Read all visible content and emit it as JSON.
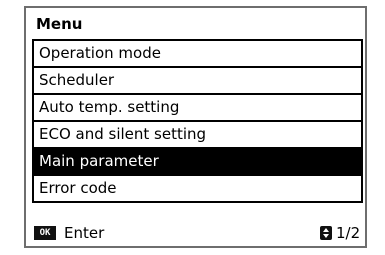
{
  "screen": {
    "title": "Menu",
    "items": [
      {
        "label": "Operation mode",
        "selected": false
      },
      {
        "label": "Scheduler",
        "selected": false
      },
      {
        "label": "Auto temp. setting",
        "selected": false
      },
      {
        "label": "ECO and silent setting",
        "selected": false
      },
      {
        "label": "Main parameter",
        "selected": true
      },
      {
        "label": "Error code",
        "selected": false
      }
    ],
    "footer": {
      "ok_badge": "OK",
      "enter_label": "Enter",
      "page_icon": "up-down-arrows-icon",
      "page_indicator": "1/2"
    }
  },
  "colors": {
    "selected_background": "#000000",
    "selected_text": "#ffffff",
    "frame_border": "#6e6e6e"
  }
}
